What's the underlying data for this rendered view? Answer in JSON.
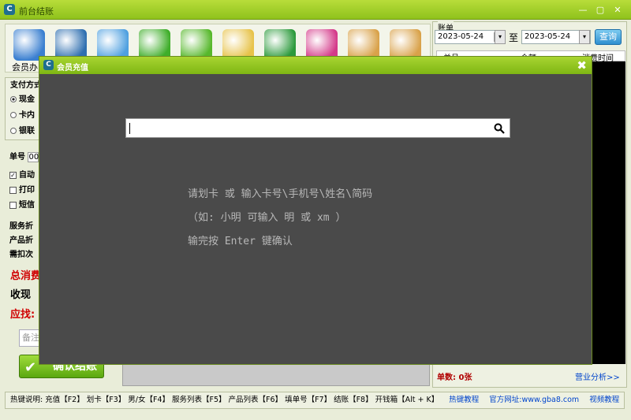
{
  "window": {
    "title": "前台结账",
    "minimize": "—",
    "maximize": "▢",
    "close": "✕"
  },
  "toolbar": {
    "first_label": "会员办",
    "tools": [
      {
        "name": "member-card-icon",
        "color": "#3a7fd0"
      },
      {
        "name": "money-bag-icon",
        "color": "#2f6fb0"
      },
      {
        "name": "card-icon",
        "color": "#4fa0e0"
      },
      {
        "name": "refresh-icon",
        "color": "#3fae2a"
      },
      {
        "name": "star-icon",
        "color": "#57b82c"
      },
      {
        "name": "notepad-icon",
        "color": "#e7c34a"
      },
      {
        "name": "phone-icon",
        "color": "#2c9a3c"
      },
      {
        "name": "gift-icon",
        "color": "#d43a8a"
      },
      {
        "name": "upload-clipboard-icon",
        "color": "#d9a24a"
      },
      {
        "name": "download-clipboard-icon",
        "color": "#d9a24a"
      }
    ]
  },
  "payment": {
    "title": "支付方式",
    "options": [
      "现金",
      "卡内",
      "银联"
    ],
    "selected": 0
  },
  "left": {
    "order_label": "单号",
    "order_value": "00",
    "checks": [
      {
        "label": "自动",
        "checked": true
      },
      {
        "label": "打印",
        "checked": false
      },
      {
        "label": "短信",
        "checked": false
      }
    ],
    "service_discount": "服务折",
    "product_discount": "产品折",
    "deduct": "需扣次",
    "total": "总消费",
    "collect": "收现",
    "change": "应找:",
    "notes_placeholder": "备注",
    "confirm": "确认结账"
  },
  "bill": {
    "title": "账单",
    "date_from": "2023-05-24",
    "to": "至",
    "date_to": "2023-05-24",
    "query": "查询",
    "columns": [
      "单号",
      "金额",
      "消费时间"
    ],
    "count": "单数: 0张",
    "analysis": "营业分析>>"
  },
  "hotkeys": {
    "text": "热键说明: 充值【F2】  划卡【F3】  男/女【F4】 服务列表【F5】 产品列表【F6】 填单号【F7】 结账【F8】 开钱箱【Alt + K】",
    "links": [
      "热键教程",
      "官方网址:www.gba8.com",
      "视频教程"
    ]
  },
  "dialog": {
    "title": "会员充值",
    "close": "✖",
    "search_value": "",
    "hints": [
      "请划卡 或 输入卡号\\手机号\\姓名\\简码",
      "（如: 小明 可输入 明 或 xm ）",
      "输完按 Enter 键确认"
    ]
  }
}
